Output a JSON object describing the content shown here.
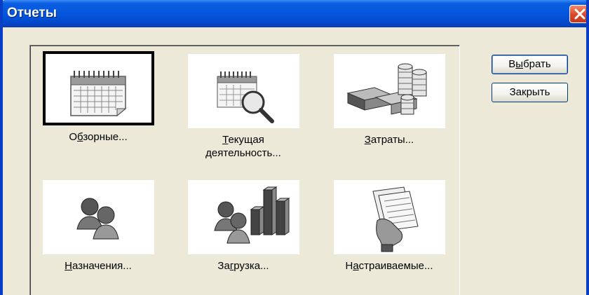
{
  "window": {
    "title": "Отчеты"
  },
  "items": [
    {
      "label": "Обзорные...",
      "pre": "О",
      "key": "б",
      "post": "зорные...",
      "icon": "calendar-icon",
      "selected": true
    },
    {
      "label": "Текущая деятельность...",
      "pre": "",
      "key": "Т",
      "post": "екущая\nдеятельность...",
      "icon": "calendar-magnifier-icon",
      "selected": false
    },
    {
      "label": "Затраты...",
      "pre": "",
      "key": "З",
      "post": "атраты...",
      "icon": "money-stacks-icon",
      "selected": false
    },
    {
      "label": "Назначения...",
      "pre": "",
      "key": "Н",
      "post": "азначения...",
      "icon": "people-icon",
      "selected": false
    },
    {
      "label": "Загрузка...",
      "pre": "За",
      "key": "г",
      "post": "рузка...",
      "icon": "people-bar-chart-icon",
      "selected": false
    },
    {
      "label": "Настраиваемые...",
      "pre": "Н",
      "key": "а",
      "post": "страиваемые...",
      "icon": "custom-report-hand-icon",
      "selected": false
    }
  ],
  "buttons": {
    "select": {
      "label": "Выбрать",
      "pre": "В",
      "key": "ы",
      "post": "брать"
    },
    "close": {
      "label": "Закрыть"
    }
  }
}
